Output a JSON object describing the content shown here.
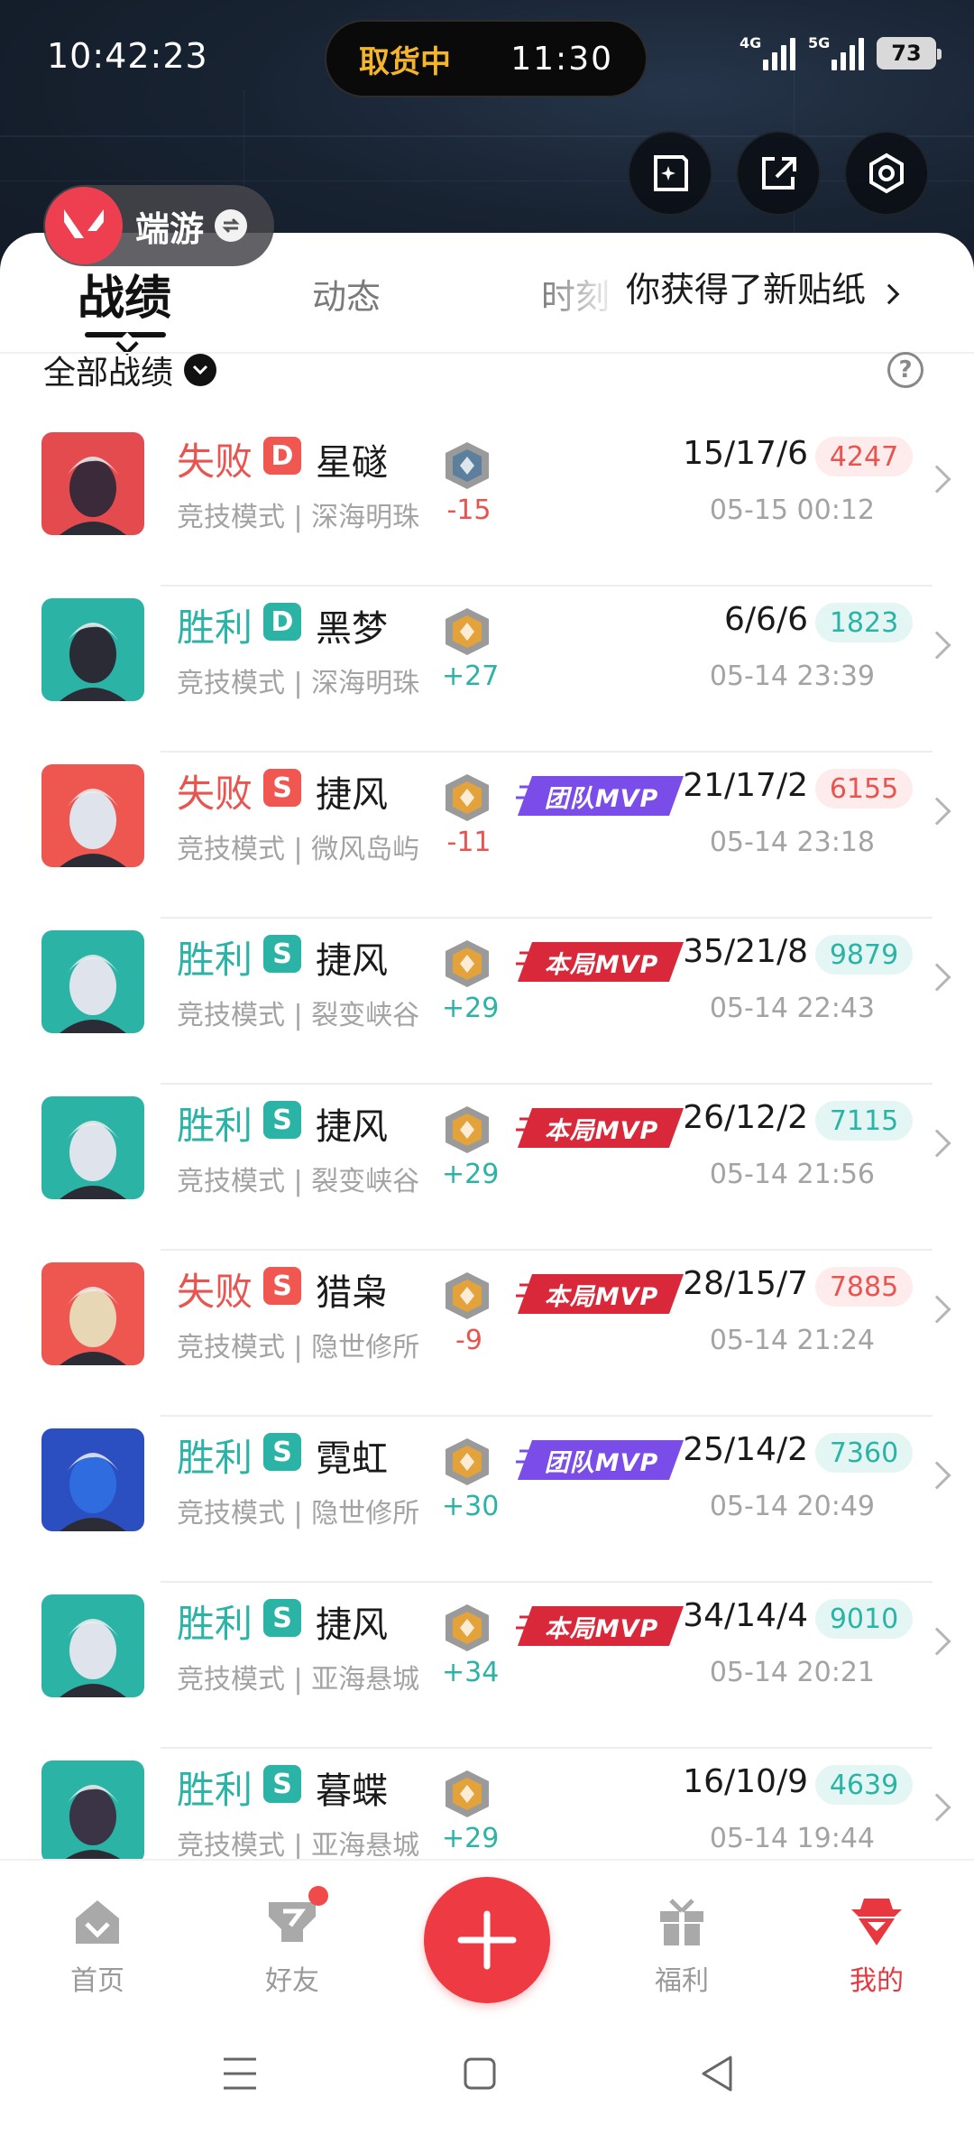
{
  "status_bar": {
    "time": "10:42:23",
    "pill_left": "取货中",
    "pill_right": "11:30",
    "net1": "4G",
    "net2": "5G",
    "battery": "73"
  },
  "header": {
    "game_label": "端游",
    "icons": [
      "sticker-edit-icon",
      "share-icon",
      "settings-icon"
    ]
  },
  "tabs": [
    {
      "label": "战绩",
      "active": true
    },
    {
      "label": "动态",
      "active": false
    },
    {
      "label": "时刻",
      "active": false
    }
  ],
  "toast": "你获得了新贴纸",
  "filter": {
    "label": "全部战绩"
  },
  "matches": [
    {
      "result": "失败",
      "rank": "D",
      "agent": "星礈",
      "mode": "竞技模式 | 深海明珠",
      "delta": "-15",
      "mvp": "",
      "kda": "15/17/6",
      "score": "4247",
      "date": "05-15 00:12",
      "win": false
    },
    {
      "result": "胜利",
      "rank": "D",
      "agent": "黑梦",
      "mode": "竞技模式 | 深海明珠",
      "delta": "+27",
      "mvp": "",
      "kda": "6/6/6",
      "score": "1823",
      "date": "05-14 23:39",
      "win": true
    },
    {
      "result": "失败",
      "rank": "S",
      "agent": "捷风",
      "mode": "竞技模式 | 微风岛屿",
      "delta": "-11",
      "mvp": "团队MVP",
      "kda": "21/17/2",
      "score": "6155",
      "date": "05-14 23:18",
      "win": false
    },
    {
      "result": "胜利",
      "rank": "S",
      "agent": "捷风",
      "mode": "竞技模式 | 裂变峡谷",
      "delta": "+29",
      "mvp": "本局MVP",
      "kda": "35/21/8",
      "score": "9879",
      "date": "05-14 22:43",
      "win": true
    },
    {
      "result": "胜利",
      "rank": "S",
      "agent": "捷风",
      "mode": "竞技模式 | 裂变峡谷",
      "delta": "+29",
      "mvp": "本局MVP",
      "kda": "26/12/2",
      "score": "7115",
      "date": "05-14 21:56",
      "win": true
    },
    {
      "result": "失败",
      "rank": "S",
      "agent": "猎枭",
      "mode": "竞技模式 | 隐世修所",
      "delta": "-9",
      "mvp": "本局MVP",
      "kda": "28/15/7",
      "score": "7885",
      "date": "05-14 21:24",
      "win": false
    },
    {
      "result": "胜利",
      "rank": "S",
      "agent": "霓虹",
      "mode": "竞技模式 | 隐世修所",
      "delta": "+30",
      "mvp": "团队MVP",
      "kda": "25/14/2",
      "score": "7360",
      "date": "05-14 20:49",
      "win": true
    },
    {
      "result": "胜利",
      "rank": "S",
      "agent": "捷风",
      "mode": "竞技模式 | 亚海悬城",
      "delta": "+34",
      "mvp": "本局MVP",
      "kda": "34/14/4",
      "score": "9010",
      "date": "05-14 20:21",
      "win": true
    },
    {
      "result": "胜利",
      "rank": "S",
      "agent": "暮蝶",
      "mode": "竞技模式 | 亚海悬城",
      "delta": "+29",
      "mvp": "",
      "kda": "16/10/9",
      "score": "4639",
      "date": "05-14 19:44",
      "win": true
    }
  ],
  "bottom_nav": [
    {
      "label": "首页",
      "icon": "home-icon"
    },
    {
      "label": "好友",
      "icon": "friends-icon"
    },
    {
      "label": "福利",
      "icon": "gift-icon"
    },
    {
      "label": "我的",
      "icon": "profile-icon"
    }
  ],
  "colors": {
    "win": "#2bb3a6",
    "lose": "#e8544f",
    "accent": "#ee3a42",
    "team_mvp": "#7a4de8",
    "match_mvp": "#d9283a"
  }
}
